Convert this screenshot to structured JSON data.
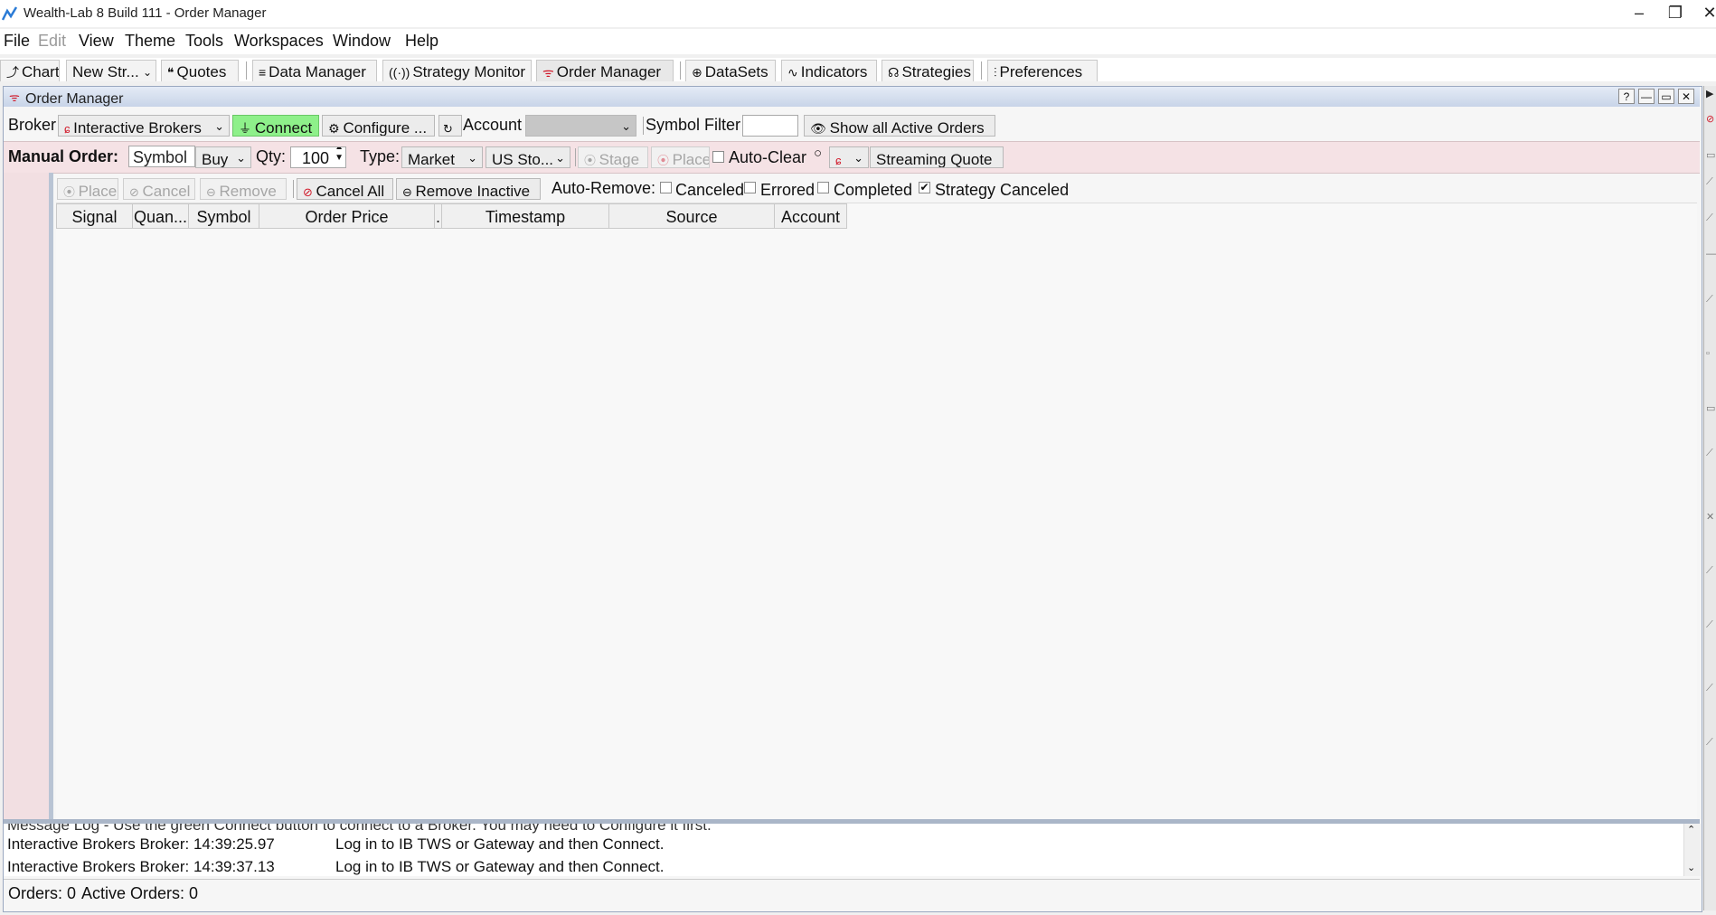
{
  "window": {
    "title": "Wealth-Lab 8 Build 111 - Order Manager",
    "controls": {
      "minimize": "–",
      "restore": "❐",
      "close": "✕"
    }
  },
  "menu": [
    "File",
    "Edit",
    "View",
    "Theme",
    "Tools",
    "Workspaces",
    "Window",
    "Help"
  ],
  "toolbar": {
    "chart": "Chart",
    "new_strategy": "New Str...",
    "quotes": "Quotes",
    "data_manager": "Data Manager",
    "strategy_monitor": "Strategy Monitor",
    "order_manager": "Order Manager",
    "datasets": "DataSets",
    "indicators": "Indicators",
    "strategies": "Strategies",
    "preferences": "Preferences"
  },
  "panel": {
    "title": "Order Manager",
    "buttons": {
      "help": "?",
      "minimize": "—",
      "maximize": "▭",
      "close": "✕"
    }
  },
  "broker_row": {
    "broker_label": "Broker",
    "broker_value": "Interactive Brokers",
    "connect": "Connect",
    "configure": "Configure ...",
    "account_label": "Account",
    "account_value": "",
    "symbol_filter_label": "Symbol Filter",
    "symbol_filter_value": "",
    "show_all": "Show all Active Orders"
  },
  "manual_order": {
    "label": "Manual Order:",
    "symbol_placeholder": "Symbol",
    "side": "Buy",
    "qty_label": "Qty:",
    "qty_value": "100",
    "type_label": "Type:",
    "type_value": "Market",
    "market": "US Sto...",
    "stage": "Stage",
    "place": "Place",
    "auto_clear": "Auto-Clear",
    "streaming_quote": "Streaming Quote"
  },
  "order_tools": {
    "place": "Place",
    "cancel": "Cancel",
    "remove": "Remove",
    "cancel_all": "Cancel All",
    "remove_inactive": "Remove Inactive",
    "auto_remove_label": "Auto-Remove:",
    "canceled": "Canceled",
    "errored": "Errored",
    "completed": "Completed",
    "strategy_canceled": "Strategy Canceled",
    "checked": {
      "canceled": false,
      "errored": false,
      "completed": false,
      "strategy_canceled": true
    }
  },
  "grid": {
    "columns": [
      "Signal",
      "Quan...",
      "Symbol",
      "",
      "Order Price",
      ".",
      "Timestamp",
      "Source",
      "Account"
    ],
    "rows": []
  },
  "log": {
    "header": "Message Log - Use the green Connect button to connect to a Broker. You may need to Configure it first.",
    "entries": [
      {
        "source": "Interactive Brokers Broker: 14:39:25.97",
        "message": "Log in to IB TWS or Gateway and then Connect."
      },
      {
        "source": "Interactive Brokers Broker: 14:39:37.13",
        "message": "Log in to IB TWS or Gateway and then Connect."
      }
    ]
  },
  "status": {
    "orders": "Orders: 0",
    "active_orders": "Active Orders: 0"
  },
  "colors": {
    "connect_bg": "#8ef08a",
    "manual_row_bg": "#f5e2e5",
    "panel_header": "#c8d4e8",
    "broker_red": "#d11a2a"
  }
}
